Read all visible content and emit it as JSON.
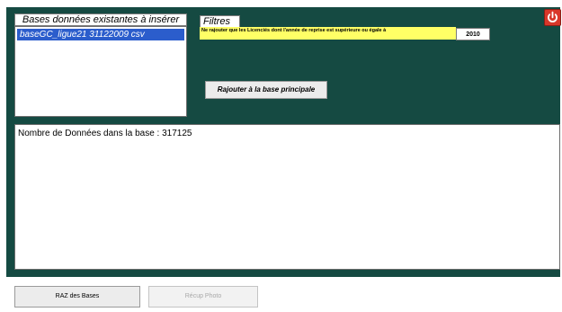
{
  "bases": {
    "label": "Bases données existantes à insérer",
    "items": [
      {
        "label": "baseGC_ligue21 31122009 csv"
      }
    ]
  },
  "filters": {
    "label": "Filtres",
    "description": "Ne rajouter que les Licenciés dont l'année de reprise est supérieure ou égale à",
    "year_value": "2010"
  },
  "actions": {
    "add_main_label": "Rajouter à la base principale",
    "reset_label": "RAZ des Bases",
    "photo_label": "Récup Photo"
  },
  "data_area": {
    "count_text": "Nombre de Données dans la base : 317125"
  },
  "colors": {
    "background": "#154a42",
    "filter_bar": "#ffff66",
    "selection": "#2b5dcc",
    "power_button": "#d9372a"
  },
  "icons": {
    "power": "power-icon"
  }
}
